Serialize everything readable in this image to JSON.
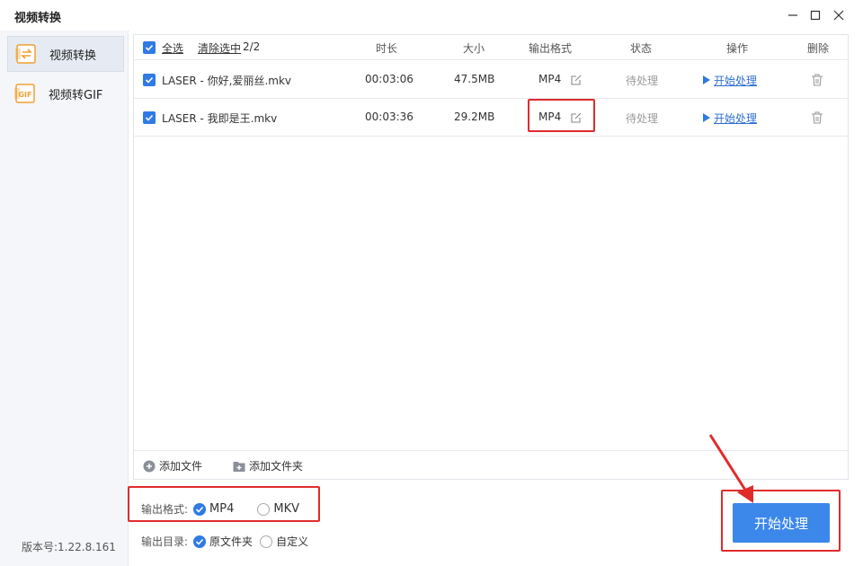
{
  "window": {
    "title": "视频转换"
  },
  "sidebar": {
    "items": [
      {
        "label": "视频转换",
        "icon": "video-convert-icon",
        "active": true
      },
      {
        "label": "视频转GIF",
        "icon": "gif-icon",
        "active": false
      }
    ],
    "version": "版本号:1.22.8.161"
  },
  "table": {
    "select_all": "全选",
    "clear_selected": "清除选中",
    "count": "2/2",
    "headers": {
      "duration": "时长",
      "size": "大小",
      "format": "输出格式",
      "status": "状态",
      "action": "操作",
      "delete": "删除"
    },
    "rows": [
      {
        "name": "LASER - 你好,爱丽丝.mkv",
        "duration": "00:03:06",
        "size": "47.5MB",
        "format": "MP4",
        "status": "待处理",
        "action": "开始处理"
      },
      {
        "name": "LASER - 我即是王.mkv",
        "duration": "00:03:36",
        "size": "29.2MB",
        "format": "MP4",
        "status": "待处理",
        "action": "开始处理"
      }
    ],
    "add_file": "添加文件",
    "add_folder": "添加文件夹"
  },
  "options": {
    "format_label": "输出格式:",
    "formats": [
      {
        "label": "MP4",
        "selected": true
      },
      {
        "label": "MKV",
        "selected": false
      }
    ],
    "dir_label": "输出目录:",
    "dirs": [
      {
        "label": "原文件夹",
        "selected": true
      },
      {
        "label": "自定义",
        "selected": false
      }
    ]
  },
  "start_button": "开始处理",
  "colors": {
    "accent": "#3c87ea",
    "annotation": "#e12b2b",
    "orange_icon": "#f0a030"
  }
}
